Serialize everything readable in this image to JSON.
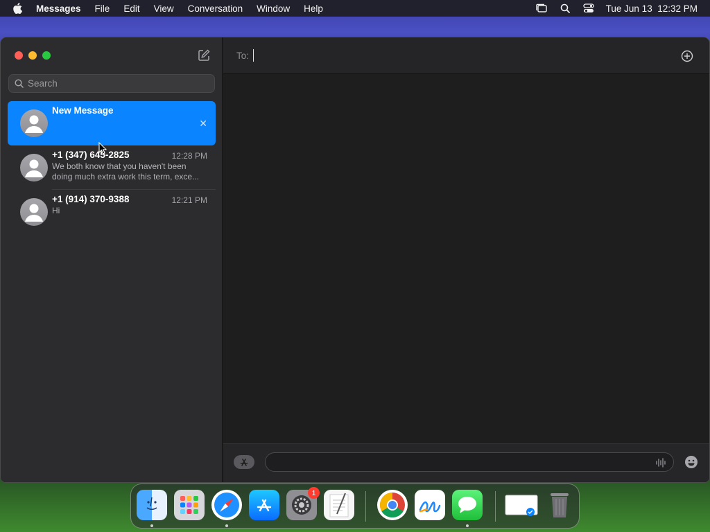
{
  "menubar": {
    "app_name": "Messages",
    "items": [
      "File",
      "Edit",
      "View",
      "Conversation",
      "Window",
      "Help"
    ],
    "clock": "Tue Jun 13  12:32 PM"
  },
  "sidebar": {
    "search_placeholder": "Search",
    "conversations": [
      {
        "name": "New Message",
        "time": "",
        "preview_line1": "",
        "preview_line2": "",
        "active": true
      },
      {
        "name": "+1 (347) 645-2825",
        "time": "12:28 PM",
        "preview_line1": "We both know that you haven't been",
        "preview_line2": "doing much extra work this term, exce...",
        "active": false
      },
      {
        "name": "+1 (914) 370-9388",
        "time": "12:21 PM",
        "preview_line1": "Hi",
        "preview_line2": "",
        "active": false
      }
    ]
  },
  "main": {
    "to_label": "To:"
  },
  "dock": {
    "apps": [
      "Finder",
      "Launchpad",
      "Safari",
      "App Store",
      "System Settings",
      "TextEdit",
      "Google Chrome",
      "Freeform",
      "Messages"
    ],
    "settings_badge": "1"
  },
  "colors": {
    "accent": "#0a84ff",
    "sidebar_bg": "#2c2c2e",
    "main_bg": "#1e1e1e"
  }
}
